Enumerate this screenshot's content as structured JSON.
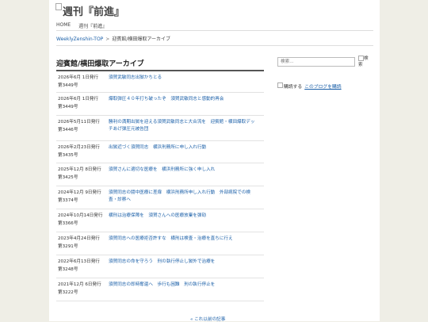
{
  "site": {
    "title": "週刊『前進』"
  },
  "nav": {
    "items": [
      "HOME",
      "週刊『前進』"
    ]
  },
  "breadcrumb": {
    "home": "WeeklyZenshin-TOP",
    "separator": ">",
    "current": "迎賓館/横田爆取アーカイブ"
  },
  "page": {
    "heading": "迎賓館/横田爆取アーカイブ"
  },
  "archive": {
    "rows": [
      {
        "date": "2026年6月 1日発行",
        "issue": "第3449号",
        "titles": [
          "須賀武敏同志出獄かちとる"
        ]
      },
      {
        "date": "2026年6月 1日発行",
        "issue": "第3449号",
        "titles": [
          "爆取弾圧４０年打ち破ったぞ　須賀武敏同志と感動的再会"
        ]
      },
      {
        "date": "2026年5月11日発行",
        "issue": "第3446号",
        "titles": [
          "勝利の満期出獄を迎える須賀武敏同志と大合流を　迎賓館・横田爆取デッ",
          "チあげ弾圧元被告団"
        ]
      },
      {
        "date": "2026年2月23日発行",
        "issue": "第3435号",
        "titles": [
          "出獄近づく須賀同志　横浜刑務所に申し入れ行動"
        ]
      },
      {
        "date": "2025年12月 8日発行",
        "issue": "第3425号",
        "titles": [
          "須賀さんに適切な医療を　横浜刑務所に強く申し入れ"
        ]
      },
      {
        "date": "2024年12月 9日発行",
        "issue": "第3374号",
        "titles": [
          "須賀同志の闘中医療に差扉　横浜刑務所申し入れ行動　外部病院での検",
          "査・診察へ"
        ]
      },
      {
        "date": "2024年10月14日発行",
        "issue": "第3366号",
        "titles": [
          "横刑は治療保障を　須賀さんへの医療放棄を弾劾"
        ]
      },
      {
        "date": "2023年4月24日発行",
        "issue": "第3291号",
        "titles": [
          "須賀同志への医療拒否許すな　横刑は検査・治療を直ちに行え"
        ]
      },
      {
        "date": "2022年6月13日発行",
        "issue": "第3248号",
        "titles": [
          "須賀同志の命を守ろう　刑の執行停止し獄外で治療を"
        ]
      },
      {
        "date": "2021年12月 6日発行",
        "issue": "第3222号",
        "titles": [
          "須賀同志の即時奪還へ　歩行も困難　刑の執行停止を"
        ]
      }
    ],
    "more_link": "« これ以前の記事"
  },
  "sidebar": {
    "search_placeholder": "検索...",
    "search_button": "検索",
    "subscribe_label": "購読する",
    "subscribe_link": "このブログを購読"
  }
}
